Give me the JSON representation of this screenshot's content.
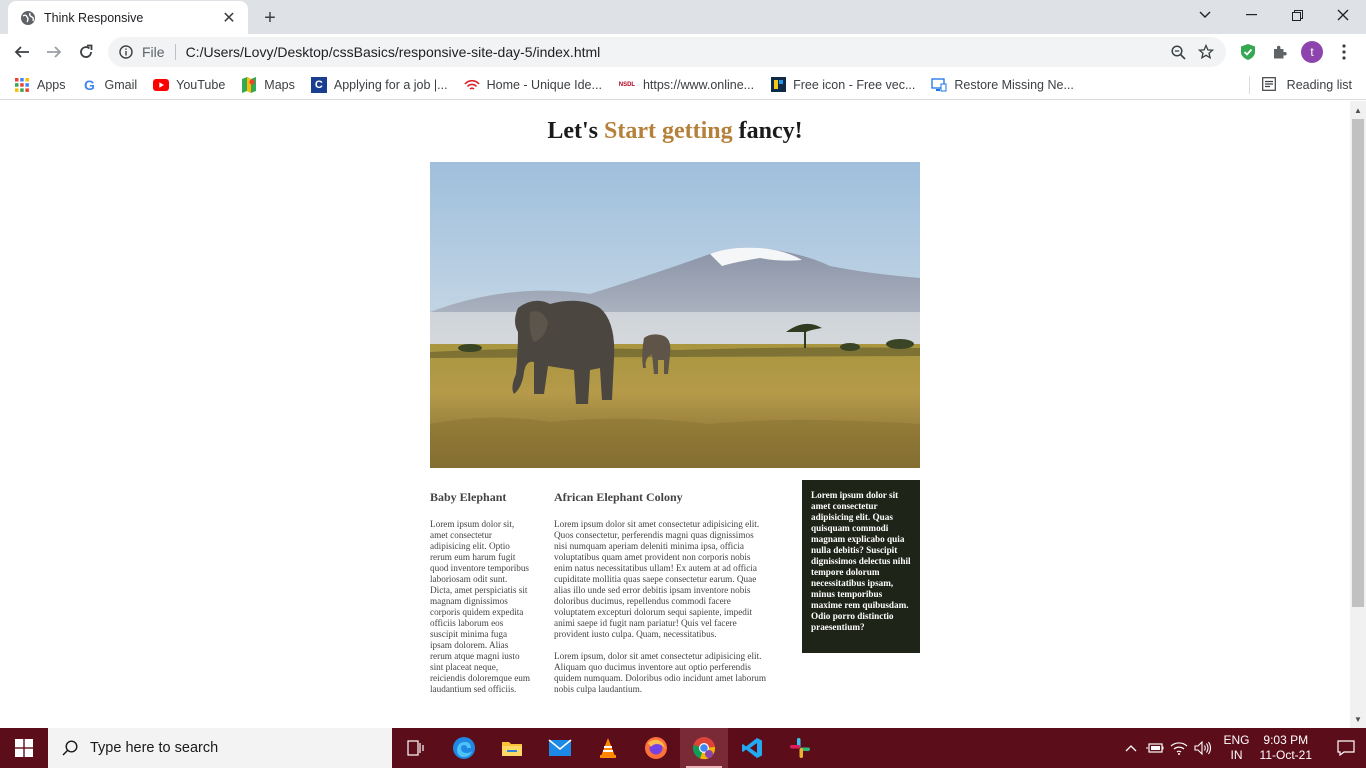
{
  "browser": {
    "tab_title": "Think Responsive",
    "url_scheme_label": "File",
    "url": "C:/Users/Lovy/Desktop/cssBasics/responsive-site-day-5/index.html",
    "profile_initial": "t",
    "bookmarks": [
      {
        "label": "Apps",
        "icon": "apps-grid-icon"
      },
      {
        "label": "Gmail",
        "icon": "google-icon"
      },
      {
        "label": "YouTube",
        "icon": "youtube-icon"
      },
      {
        "label": "Maps",
        "icon": "maps-icon"
      },
      {
        "label": "Applying for a job |...",
        "icon": "c-logo-icon"
      },
      {
        "label": "Home - Unique Ide...",
        "icon": "wifi-logo-icon"
      },
      {
        "label": "https://www.online...",
        "icon": "nsdl-icon"
      },
      {
        "label": "Free icon - Free vec...",
        "icon": "freepik-icon"
      },
      {
        "label": "Restore Missing Ne...",
        "icon": "monitor-icon"
      }
    ],
    "reading_list": "Reading list"
  },
  "page": {
    "heading": {
      "part1": "Let's ",
      "accent": "Start getting",
      "part2": " fancy!",
      "accent_color": "#b5803a"
    },
    "col1": {
      "title": "Baby Elephant",
      "text": "Lorem ipsum dolor sit, amet consectetur adipisicing elit. Optio rerum eum harum fugit quod inventore temporibus laboriosam odit sunt. Dicta, amet perspiciatis sit magnam dignissimos corporis quidem expedita officiis laborum eos suscipit minima fuga ipsam dolorem. Alias rerum atque magni iusto sint placeat neque, reiciendis doloremque eum laudantium sed officiis."
    },
    "col2": {
      "title": "African Elephant Colony",
      "para1": "Lorem ipsum dolor sit amet consectetur adipisicing elit. Quos consectetur, perferendis magni quas dignissimos nisi numquam aperiam deleniti minima ipsa, officia voluptatibus quam amet provident non corporis nobis enim natus necessitatibus ullam! Ex autem at ad officia cupiditate mollitia quas saepe consectetur earum. Quae alias illo unde sed error debitis ipsam inventore nobis doloribus ducimus, repellendus commodi facere voluptatem excepturi dolorum sequi sapiente, impedit animi saepe id fugit nam pariatur! Quis vel facere provident iusto culpa. Quam, necessitatibus.",
      "para2": "Lorem ipsum, dolor sit amet consectetur adipisicing elit. Aliquam quo ducimus inventore aut optio perferendis quidem numquam. Doloribus odio incidunt amet laborum nobis culpa laudantium."
    },
    "aside": {
      "text": "Lorem ipsum dolor sit amet consectetur adipisicing elit. Quas quisquam commodi magnam explicabo quia nulla debitis? Suscipit dignissimos delectus nihil tempore dolorum necessitatibus ipsam, minus temporibus maxime rem quibusdam. Odio porro distinctio praesentium?",
      "background": "#1f2418"
    }
  },
  "taskbar": {
    "search_placeholder": "Type here to search",
    "lang_line1": "ENG",
    "lang_line2": "IN",
    "time": "9:03 PM",
    "date": "11-Oct-21",
    "background": "#5c0d1a"
  }
}
